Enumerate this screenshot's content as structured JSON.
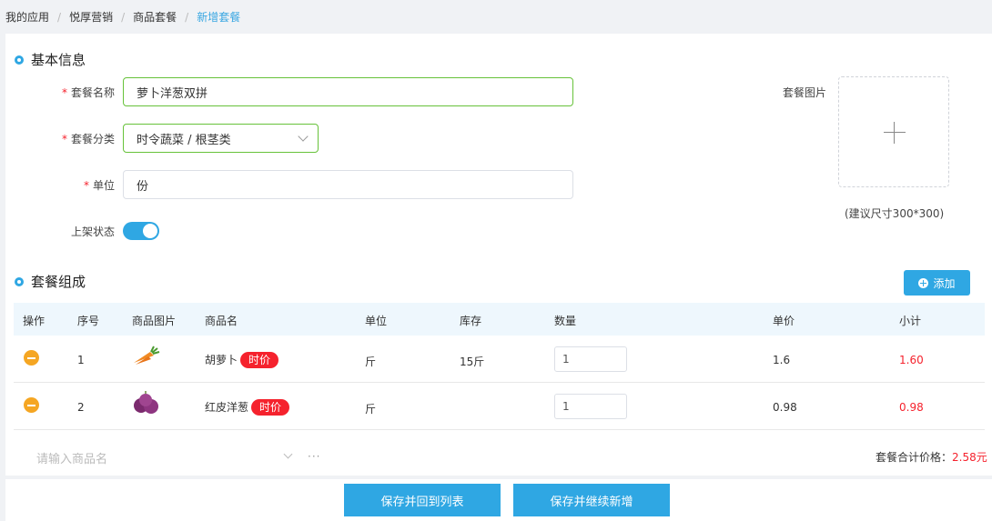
{
  "breadcrumb": [
    "我的应用",
    "悦厚营销",
    "商品套餐",
    "新增套餐"
  ],
  "basic_info": {
    "title": "基本信息",
    "name_label": "套餐名称",
    "name_value": "萝卜洋葱双拼",
    "category_label": "套餐分类",
    "category_value": "时令蔬菜 / 根茎类",
    "unit_label": "单位",
    "unit_value": "份",
    "status_label": "上架状态",
    "status_on": true,
    "image_label": "套餐图片",
    "image_hint": "(建议尺寸300*300)"
  },
  "composition": {
    "title": "套餐组成",
    "add_label": "添加",
    "columns": [
      "操作",
      "序号",
      "商品图片",
      "商品名",
      "单位",
      "库存",
      "数量",
      "单价",
      "小计"
    ],
    "rows": [
      {
        "index": "1",
        "name": "胡萝卜",
        "tag": "时价",
        "unit": "斤",
        "stock": "15斤",
        "qty": "1",
        "price": "1.6",
        "subtotal": "1.60",
        "image": "carrot-icon"
      },
      {
        "index": "2",
        "name": "红皮洋葱",
        "tag": "时价",
        "unit": "斤",
        "stock": "",
        "qty": "1",
        "price": "0.98",
        "subtotal": "0.98",
        "image": "onion-icon"
      }
    ],
    "search_placeholder": "请输入商品名",
    "more": "···",
    "total_label": "套餐合计价格：",
    "total_value": "2.58元"
  },
  "footer": {
    "save_return": "保存并回到列表",
    "save_continue": "保存并继续新增"
  },
  "colors": {
    "accent": "#2fa7e3",
    "danger": "#f5222d",
    "warn": "#f5a623",
    "success": "#67c23a"
  }
}
